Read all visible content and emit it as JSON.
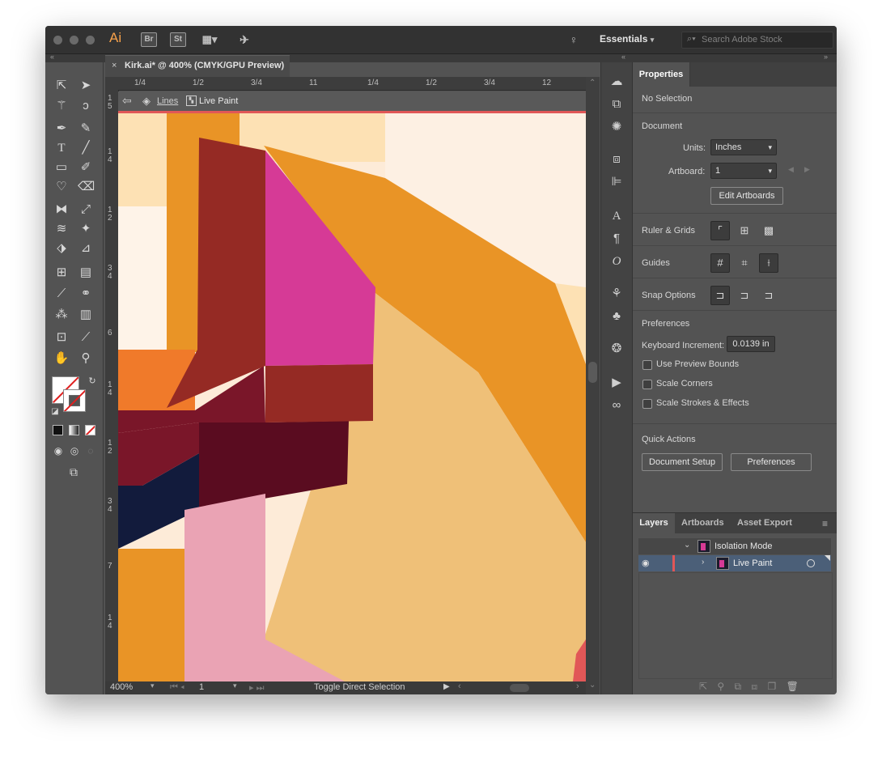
{
  "app": {
    "logo": "Ai",
    "bridge": "Br",
    "stock": "St",
    "workspace": "Essentials",
    "search_placeholder": "Search Adobe Stock"
  },
  "document": {
    "tab_title": "Kirk.ai* @ 400% (CMYK/GPU Preview)",
    "close": "×"
  },
  "rulers": {
    "h_ticks": [
      "1/4",
      "1/2",
      "3/4",
      "11",
      "1/4",
      "1/2",
      "3/4",
      "12"
    ],
    "v_ticks": [
      "1 5",
      "1 4",
      "1 2",
      "3 4",
      "6",
      "1 4",
      "1 2",
      "3 4",
      "7",
      "1 4"
    ]
  },
  "isolation": {
    "back_icon": "⇦",
    "crumb_1": "Lines",
    "crumb_2": "Live Paint"
  },
  "statusbar": {
    "zoom": "400%",
    "artboard": "1",
    "message": "Toggle Direct Selection"
  },
  "properties": {
    "tab": "Properties",
    "selection": "No Selection",
    "document_label": "Document",
    "units_label": "Units:",
    "units_value": "Inches",
    "artboard_label": "Artboard:",
    "artboard_value": "1",
    "edit_artboards": "Edit Artboards",
    "ruler_grids": "Ruler & Grids",
    "guides": "Guides",
    "snap_options": "Snap Options",
    "preferences_label": "Preferences",
    "keyboard_increment_label": "Keyboard Increment:",
    "keyboard_increment_value": "0.0139 in",
    "use_preview_bounds": "Use Preview Bounds",
    "scale_corners": "Scale Corners",
    "scale_strokes": "Scale Strokes & Effects",
    "quick_actions": "Quick Actions",
    "document_setup": "Document Setup",
    "preferences_button": "Preferences"
  },
  "layers": {
    "tabs": [
      "Layers",
      "Artboards",
      "Asset Export"
    ],
    "rows": [
      {
        "name": "Isolation Mode"
      },
      {
        "name": "Live Paint"
      }
    ]
  },
  "colors": {
    "canvas_cream": "#fdebd8",
    "orange": "#e99426",
    "magenta": "#d63a96",
    "dark_red": "#952a24",
    "accent_red": "#e15757"
  }
}
